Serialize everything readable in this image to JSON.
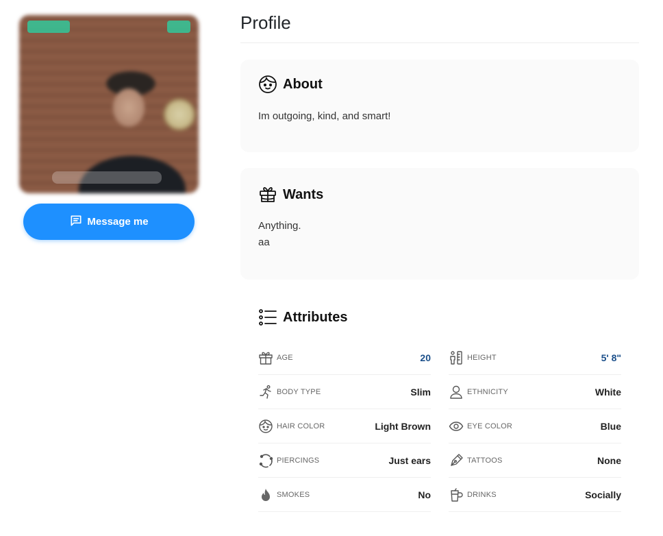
{
  "profile": {
    "title": "Profile",
    "message_button": "Message me"
  },
  "about": {
    "heading": "About",
    "text": "Im outgoing, kind, and smart!"
  },
  "wants": {
    "heading": "Wants",
    "line1": "Anything.",
    "line2": "aa"
  },
  "attributes": {
    "heading": "Attributes",
    "items": [
      {
        "icon": "gift-icon",
        "label": "AGE",
        "value": "20"
      },
      {
        "icon": "ruler-person-icon",
        "label": "HEIGHT",
        "value": "5' 8\""
      },
      {
        "icon": "running-figure-icon",
        "label": "BODY TYPE",
        "value": "Slim"
      },
      {
        "icon": "person-icon",
        "label": "ETHNICITY",
        "value": "White"
      },
      {
        "icon": "face-icon",
        "label": "HAIR COLOR",
        "value": "Light Brown"
      },
      {
        "icon": "eye-icon",
        "label": "EYE COLOR",
        "value": "Blue"
      },
      {
        "icon": "piercing-ring-icon",
        "label": "PIERCINGS",
        "value": "Just ears"
      },
      {
        "icon": "tattoo-pen-icon",
        "label": "TATTOOS",
        "value": "None"
      },
      {
        "icon": "flame-icon",
        "label": "SMOKES",
        "value": "No"
      },
      {
        "icon": "drink-glass-icon",
        "label": "DRINKS",
        "value": "Socially"
      }
    ]
  },
  "colors": {
    "accent": "#1e90ff",
    "numeric_value": "#1b4f8a",
    "card_background": "#fafafa"
  }
}
